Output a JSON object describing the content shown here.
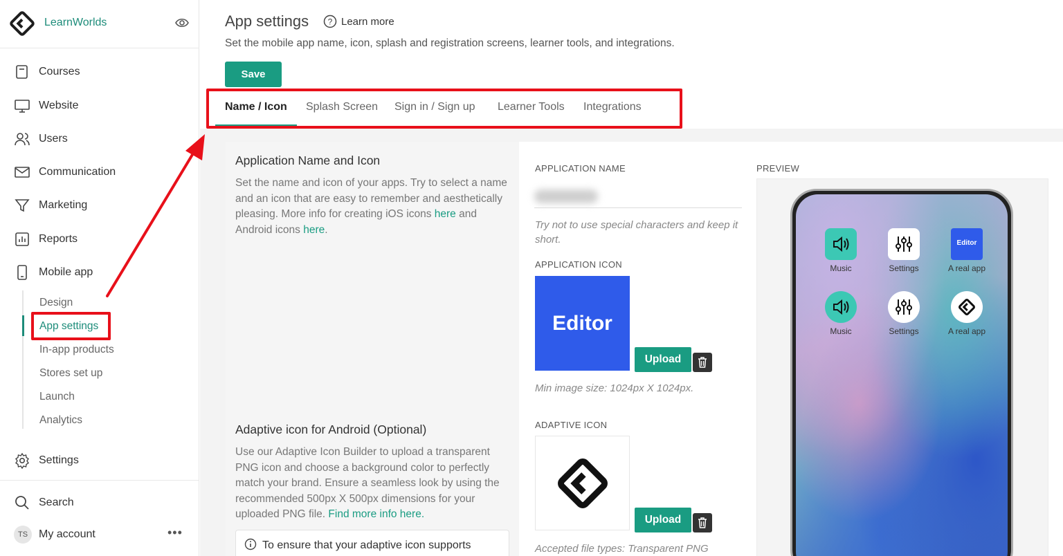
{
  "brand": {
    "name": "LearnWorlds"
  },
  "sidebar": {
    "items": [
      {
        "label": "Courses",
        "icon": "book-icon"
      },
      {
        "label": "Website",
        "icon": "monitor-icon"
      },
      {
        "label": "Users",
        "icon": "users-icon"
      },
      {
        "label": "Communication",
        "icon": "mail-icon"
      },
      {
        "label": "Marketing",
        "icon": "funnel-icon"
      },
      {
        "label": "Reports",
        "icon": "chart-icon"
      },
      {
        "label": "Mobile app",
        "icon": "phone-icon"
      }
    ],
    "subitems": [
      {
        "label": "Design"
      },
      {
        "label": "App settings"
      },
      {
        "label": "In-app products"
      },
      {
        "label": "Stores set up"
      },
      {
        "label": "Launch"
      },
      {
        "label": "Analytics"
      }
    ],
    "settings": "Settings",
    "search": "Search",
    "account": {
      "initials": "TS",
      "label": "My account",
      "more": "•••"
    }
  },
  "header": {
    "title": "App settings",
    "learn_more": "Learn more",
    "description": "Set the mobile app name, icon, splash and registration screens, learner tools, and integrations.",
    "save_label": "Save"
  },
  "tabs": [
    {
      "label": "Name / Icon",
      "active": true
    },
    {
      "label": "Splash Screen"
    },
    {
      "label": "Sign in / Sign up"
    },
    {
      "label": "Learner Tools"
    },
    {
      "label": "Integrations"
    }
  ],
  "app_name_section": {
    "title": "Application Name and Icon",
    "text_1": "Set the name and icon of your apps. Try to select a name and an icon that are easy to remember and aesthetically pleasing. More info for creating iOS icons ",
    "link_1": "here",
    "text_2": " and Android icons ",
    "link_2": "here",
    "text_3": "."
  },
  "adaptive_section": {
    "title": "Adaptive icon for Android (Optional)",
    "text": "Use our Adaptive Icon Builder to upload a transparent PNG icon and choose a background color to perfectly match your brand. Ensure a seamless look by using the recommended 500px X 500px dimensions for your uploaded PNG file. ",
    "link": "Find more info here.",
    "info": "To ensure that your adaptive icon supports"
  },
  "fields": {
    "app_name_label": "APPLICATION NAME",
    "app_name_hint": "Try not to use special characters and keep it short.",
    "app_icon_label": "APPLICATION ICON",
    "app_icon_text": "Editor",
    "upload_label": "Upload",
    "min_size_hint": "Min image size: 1024px X 1024px.",
    "adaptive_icon_label": "ADAPTIVE ICON",
    "accepted_hint": "Accepted file types: Transparent PNG"
  },
  "preview": {
    "label": "PREVIEW",
    "apps": [
      {
        "caption": "Music",
        "icon": "speaker-icon"
      },
      {
        "caption": "Settings",
        "icon": "sliders-icon"
      },
      {
        "caption": "A real app",
        "icon": "editor-tile",
        "text": "Editor"
      },
      {
        "caption": "Music",
        "icon": "speaker-icon"
      },
      {
        "caption": "Settings",
        "icon": "sliders-icon"
      },
      {
        "caption": "A real app",
        "icon": "learnworlds-logo-icon"
      }
    ]
  },
  "colors": {
    "accent": "#1a9c82",
    "annotation": "#e8101a",
    "editor_blue": "#2f5bea",
    "music_teal": "#3cc8b4"
  }
}
